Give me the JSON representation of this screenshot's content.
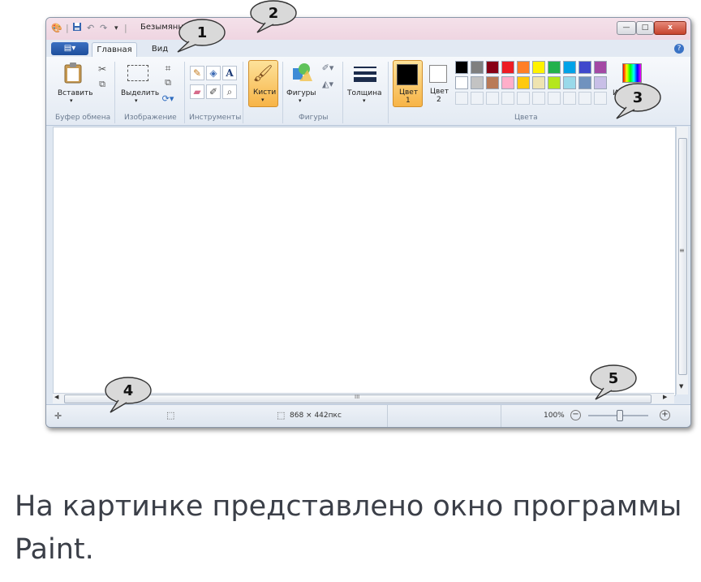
{
  "window": {
    "title": "Безымянн",
    "quick_access": {
      "save_icon": "save-icon",
      "undo_icon": "undo-icon",
      "redo_icon": "redo-icon",
      "customize": "▾"
    },
    "controls": {
      "minimize": "—",
      "maximize": "□",
      "close": "x"
    }
  },
  "tabs": {
    "file_button": "▤▾",
    "home": "Главная",
    "view": "Вид",
    "help": "?"
  },
  "ribbon": {
    "clipboard": {
      "label": "Буфер обмена",
      "paste": "Вставить"
    },
    "image": {
      "label": "Изображение",
      "select": "Выделить"
    },
    "tools": {
      "label": "Инструменты"
    },
    "brushes": {
      "label": "Кисти"
    },
    "shapes": {
      "label": "Фигуры",
      "button": "Фигуры"
    },
    "thickness": {
      "label": "Толщина"
    },
    "colors": {
      "label": "Цвета",
      "color1_line1": "Цвет",
      "color1_line2": "1",
      "color2_line1": "Цвет",
      "color2_line2": "2",
      "edit_colors": "И",
      "palette_row1": [
        "#000000",
        "#7f7f7f",
        "#880015",
        "#ed1c24",
        "#ff7f27",
        "#fff200",
        "#22b14c",
        "#00a2e8",
        "#3f48cc",
        "#a349a4"
      ],
      "palette_row2": [
        "#ffffff",
        "#c3c3c3",
        "#b97a57",
        "#ffaec9",
        "#ffc90e",
        "#efe4b0",
        "#b5e61d",
        "#99d9ea",
        "#7092be",
        "#c8bfe7"
      ]
    }
  },
  "status": {
    "size": "868 × 442пкс",
    "zoom": "100%"
  },
  "scroll": {
    "grip": "≡",
    "h_grip": "III"
  },
  "callouts": [
    "1",
    "2",
    "3",
    "4",
    "5"
  ],
  "caption": {
    "line1": "На картинке представлено окно программы",
    "line2": "Paint."
  }
}
